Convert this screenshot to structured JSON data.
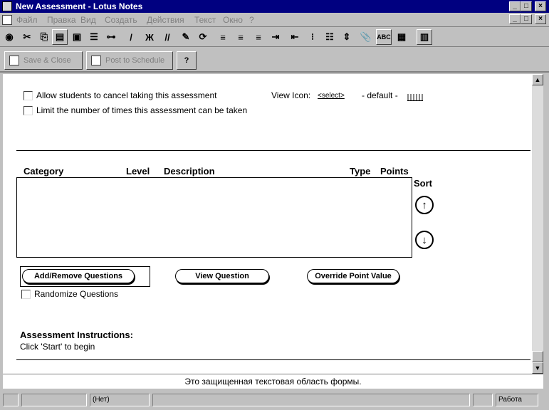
{
  "window": {
    "title": "New Assessment - Lotus Notes",
    "min": "_",
    "max": "□",
    "close": "×"
  },
  "menu": {
    "items": [
      "Файл",
      "Правка",
      "Вид",
      "Создать",
      "Действия",
      "Текст",
      "Окно",
      "?"
    ]
  },
  "toolbar": {
    "icons": [
      "open-db-icon",
      "cut-icon",
      "copy-icon",
      "paste-icon",
      "print-icon",
      "properties-icon",
      "link-icon",
      "italic-icon",
      "bold-icon",
      "underline-icon",
      "spell-icon",
      "refresh-icon",
      "align-left-icon",
      "align-center-icon",
      "align-right-icon",
      "indent-icon",
      "outdent-icon",
      "bullets-icon",
      "numbering-icon",
      "attach-icon",
      "abc-icon",
      "table-icon",
      "grid-icon"
    ],
    "bold_glyph": "Ж",
    "italic_glyph": "//"
  },
  "actions": {
    "save_close": "Save & Close",
    "post_schedule": "Post to Schedule",
    "help": "?"
  },
  "form": {
    "allow_cancel_label": "Allow students to cancel taking this assessment",
    "limit_times_label": "Limit the number of times this assessment can be taken",
    "view_icon_label": "View Icon:",
    "select_link": "<select>",
    "default_value": "- default -",
    "columns": {
      "category": "Category",
      "level": "Level",
      "description": "Description",
      "type": "Type",
      "points": "Points"
    },
    "sort_label": "Sort",
    "add_remove_button": "Add/Remove Questions",
    "view_question_button": "View Question",
    "override_button": "Override Point Value",
    "randomize_label": "Randomize Questions",
    "instructions_heading": "Assessment Instructions:",
    "instructions_text": "Click 'Start' to begin"
  },
  "message": "Это защищенная текстовая область формы.",
  "status": {
    "panel2": "(Нет)",
    "panel_right": "Работа"
  }
}
